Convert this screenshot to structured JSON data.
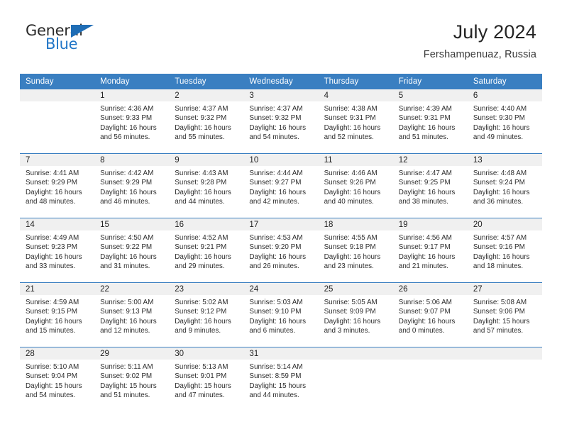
{
  "brand": {
    "name_part1": "General",
    "name_part2": "Blue",
    "triangle_color": "#1f6db5",
    "blue_text_color": "#2176c7"
  },
  "header": {
    "title": "July 2024",
    "location": "Fershampenuaz, Russia"
  },
  "theme": {
    "header_bg": "#3a7fc1",
    "header_text": "#ffffff",
    "daynum_band_bg": "#f0f0f0",
    "row_divider": "#3a7fc1",
    "body_text": "#2d2d2d"
  },
  "weekday_headers": [
    "Sunday",
    "Monday",
    "Tuesday",
    "Wednesday",
    "Thursday",
    "Friday",
    "Saturday"
  ],
  "labels": {
    "sunrise_prefix": "Sunrise:",
    "sunset_prefix": "Sunset:",
    "daylight_prefix": "Daylight:"
  },
  "weeks": [
    [
      {
        "day": "",
        "sunrise": "",
        "sunset": "",
        "daylight_line1": "",
        "daylight_line2": "",
        "empty": true
      },
      {
        "day": "1",
        "sunrise": "Sunrise: 4:36 AM",
        "sunset": "Sunset: 9:33 PM",
        "daylight_line1": "Daylight: 16 hours",
        "daylight_line2": "and 56 minutes.",
        "empty": false
      },
      {
        "day": "2",
        "sunrise": "Sunrise: 4:37 AM",
        "sunset": "Sunset: 9:32 PM",
        "daylight_line1": "Daylight: 16 hours",
        "daylight_line2": "and 55 minutes.",
        "empty": false
      },
      {
        "day": "3",
        "sunrise": "Sunrise: 4:37 AM",
        "sunset": "Sunset: 9:32 PM",
        "daylight_line1": "Daylight: 16 hours",
        "daylight_line2": "and 54 minutes.",
        "empty": false
      },
      {
        "day": "4",
        "sunrise": "Sunrise: 4:38 AM",
        "sunset": "Sunset: 9:31 PM",
        "daylight_line1": "Daylight: 16 hours",
        "daylight_line2": "and 52 minutes.",
        "empty": false
      },
      {
        "day": "5",
        "sunrise": "Sunrise: 4:39 AM",
        "sunset": "Sunset: 9:31 PM",
        "daylight_line1": "Daylight: 16 hours",
        "daylight_line2": "and 51 minutes.",
        "empty": false
      },
      {
        "day": "6",
        "sunrise": "Sunrise: 4:40 AM",
        "sunset": "Sunset: 9:30 PM",
        "daylight_line1": "Daylight: 16 hours",
        "daylight_line2": "and 49 minutes.",
        "empty": false
      }
    ],
    [
      {
        "day": "7",
        "sunrise": "Sunrise: 4:41 AM",
        "sunset": "Sunset: 9:29 PM",
        "daylight_line1": "Daylight: 16 hours",
        "daylight_line2": "and 48 minutes.",
        "empty": false
      },
      {
        "day": "8",
        "sunrise": "Sunrise: 4:42 AM",
        "sunset": "Sunset: 9:29 PM",
        "daylight_line1": "Daylight: 16 hours",
        "daylight_line2": "and 46 minutes.",
        "empty": false
      },
      {
        "day": "9",
        "sunrise": "Sunrise: 4:43 AM",
        "sunset": "Sunset: 9:28 PM",
        "daylight_line1": "Daylight: 16 hours",
        "daylight_line2": "and 44 minutes.",
        "empty": false
      },
      {
        "day": "10",
        "sunrise": "Sunrise: 4:44 AM",
        "sunset": "Sunset: 9:27 PM",
        "daylight_line1": "Daylight: 16 hours",
        "daylight_line2": "and 42 minutes.",
        "empty": false
      },
      {
        "day": "11",
        "sunrise": "Sunrise: 4:46 AM",
        "sunset": "Sunset: 9:26 PM",
        "daylight_line1": "Daylight: 16 hours",
        "daylight_line2": "and 40 minutes.",
        "empty": false
      },
      {
        "day": "12",
        "sunrise": "Sunrise: 4:47 AM",
        "sunset": "Sunset: 9:25 PM",
        "daylight_line1": "Daylight: 16 hours",
        "daylight_line2": "and 38 minutes.",
        "empty": false
      },
      {
        "day": "13",
        "sunrise": "Sunrise: 4:48 AM",
        "sunset": "Sunset: 9:24 PM",
        "daylight_line1": "Daylight: 16 hours",
        "daylight_line2": "and 36 minutes.",
        "empty": false
      }
    ],
    [
      {
        "day": "14",
        "sunrise": "Sunrise: 4:49 AM",
        "sunset": "Sunset: 9:23 PM",
        "daylight_line1": "Daylight: 16 hours",
        "daylight_line2": "and 33 minutes.",
        "empty": false
      },
      {
        "day": "15",
        "sunrise": "Sunrise: 4:50 AM",
        "sunset": "Sunset: 9:22 PM",
        "daylight_line1": "Daylight: 16 hours",
        "daylight_line2": "and 31 minutes.",
        "empty": false
      },
      {
        "day": "16",
        "sunrise": "Sunrise: 4:52 AM",
        "sunset": "Sunset: 9:21 PM",
        "daylight_line1": "Daylight: 16 hours",
        "daylight_line2": "and 29 minutes.",
        "empty": false
      },
      {
        "day": "17",
        "sunrise": "Sunrise: 4:53 AM",
        "sunset": "Sunset: 9:20 PM",
        "daylight_line1": "Daylight: 16 hours",
        "daylight_line2": "and 26 minutes.",
        "empty": false
      },
      {
        "day": "18",
        "sunrise": "Sunrise: 4:55 AM",
        "sunset": "Sunset: 9:18 PM",
        "daylight_line1": "Daylight: 16 hours",
        "daylight_line2": "and 23 minutes.",
        "empty": false
      },
      {
        "day": "19",
        "sunrise": "Sunrise: 4:56 AM",
        "sunset": "Sunset: 9:17 PM",
        "daylight_line1": "Daylight: 16 hours",
        "daylight_line2": "and 21 minutes.",
        "empty": false
      },
      {
        "day": "20",
        "sunrise": "Sunrise: 4:57 AM",
        "sunset": "Sunset: 9:16 PM",
        "daylight_line1": "Daylight: 16 hours",
        "daylight_line2": "and 18 minutes.",
        "empty": false
      }
    ],
    [
      {
        "day": "21",
        "sunrise": "Sunrise: 4:59 AM",
        "sunset": "Sunset: 9:15 PM",
        "daylight_line1": "Daylight: 16 hours",
        "daylight_line2": "and 15 minutes.",
        "empty": false
      },
      {
        "day": "22",
        "sunrise": "Sunrise: 5:00 AM",
        "sunset": "Sunset: 9:13 PM",
        "daylight_line1": "Daylight: 16 hours",
        "daylight_line2": "and 12 minutes.",
        "empty": false
      },
      {
        "day": "23",
        "sunrise": "Sunrise: 5:02 AM",
        "sunset": "Sunset: 9:12 PM",
        "daylight_line1": "Daylight: 16 hours",
        "daylight_line2": "and 9 minutes.",
        "empty": false
      },
      {
        "day": "24",
        "sunrise": "Sunrise: 5:03 AM",
        "sunset": "Sunset: 9:10 PM",
        "daylight_line1": "Daylight: 16 hours",
        "daylight_line2": "and 6 minutes.",
        "empty": false
      },
      {
        "day": "25",
        "sunrise": "Sunrise: 5:05 AM",
        "sunset": "Sunset: 9:09 PM",
        "daylight_line1": "Daylight: 16 hours",
        "daylight_line2": "and 3 minutes.",
        "empty": false
      },
      {
        "day": "26",
        "sunrise": "Sunrise: 5:06 AM",
        "sunset": "Sunset: 9:07 PM",
        "daylight_line1": "Daylight: 16 hours",
        "daylight_line2": "and 0 minutes.",
        "empty": false
      },
      {
        "day": "27",
        "sunrise": "Sunrise: 5:08 AM",
        "sunset": "Sunset: 9:06 PM",
        "daylight_line1": "Daylight: 15 hours",
        "daylight_line2": "and 57 minutes.",
        "empty": false
      }
    ],
    [
      {
        "day": "28",
        "sunrise": "Sunrise: 5:10 AM",
        "sunset": "Sunset: 9:04 PM",
        "daylight_line1": "Daylight: 15 hours",
        "daylight_line2": "and 54 minutes.",
        "empty": false
      },
      {
        "day": "29",
        "sunrise": "Sunrise: 5:11 AM",
        "sunset": "Sunset: 9:02 PM",
        "daylight_line1": "Daylight: 15 hours",
        "daylight_line2": "and 51 minutes.",
        "empty": false
      },
      {
        "day": "30",
        "sunrise": "Sunrise: 5:13 AM",
        "sunset": "Sunset: 9:01 PM",
        "daylight_line1": "Daylight: 15 hours",
        "daylight_line2": "and 47 minutes.",
        "empty": false
      },
      {
        "day": "31",
        "sunrise": "Sunrise: 5:14 AM",
        "sunset": "Sunset: 8:59 PM",
        "daylight_line1": "Daylight: 15 hours",
        "daylight_line2": "and 44 minutes.",
        "empty": false
      },
      {
        "day": "",
        "sunrise": "",
        "sunset": "",
        "daylight_line1": "",
        "daylight_line2": "",
        "empty": true
      },
      {
        "day": "",
        "sunrise": "",
        "sunset": "",
        "daylight_line1": "",
        "daylight_line2": "",
        "empty": true
      },
      {
        "day": "",
        "sunrise": "",
        "sunset": "",
        "daylight_line1": "",
        "daylight_line2": "",
        "empty": true
      }
    ]
  ]
}
